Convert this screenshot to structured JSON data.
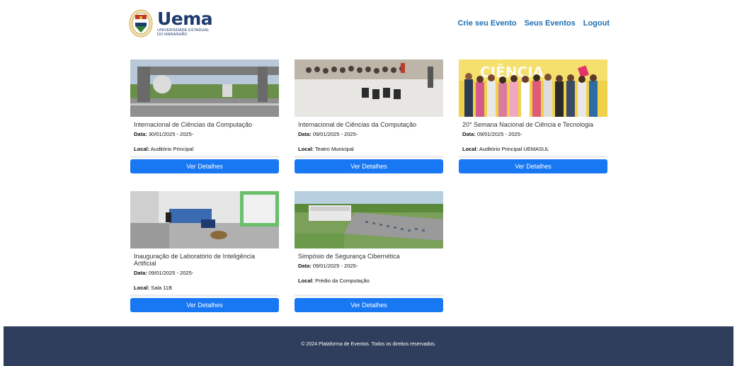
{
  "header": {
    "brand_name": "Uema",
    "brand_sub": "UNIVERSIDADE ESTADUAL DO MARANHÃO",
    "nav": [
      "Crie seu Evento",
      "Seus Eventos",
      "Logout"
    ]
  },
  "labels": {
    "date": "Data:",
    "local": "Local:"
  },
  "events": [
    {
      "title": "Internacional de Ciências da Computação",
      "date": "30/01/2025 - 2025-",
      "local": "Auditório Principal",
      "button": "Ver Detalhes",
      "image": "campus-gate-photo"
    },
    {
      "title": "Internacional de Ciências da Computação",
      "date": "09/01/2025 - 2025-",
      "local": "Teatro Municipal",
      "button": "Ver Detalhes",
      "image": "auditorium-audience-photo"
    },
    {
      "title": "20° Semana Nacional de Ciência e Tecnologia",
      "date": "09/01/2025 - 2025-",
      "local": "Auditório Principal UEMASUL",
      "button": "Ver Detalhes",
      "image": "group-photo-ciencia"
    },
    {
      "title": "Inauguração de Laboratório de Inteligência Artificial",
      "date": "09/01/2025 - 2025-",
      "local": "Sala 11B",
      "button": "Ver Detalhes",
      "image": "lab-room-photo"
    },
    {
      "title": "Simpósio de Segurança Cibernética",
      "date": "09/01/2025 - 2025-",
      "local": "Prédio da Computação",
      "button": "Ver Detalhes",
      "image": "aerial-campus-render"
    }
  ],
  "footer": {
    "text": "© 2024 Plataforma de Eventos. Todos os direitos reservados."
  },
  "colors": {
    "primary_button": "#1877f2",
    "nav_link": "#1f6fb2",
    "footer_bg": "#2f3e5c",
    "brand": "#1e3a6e"
  }
}
